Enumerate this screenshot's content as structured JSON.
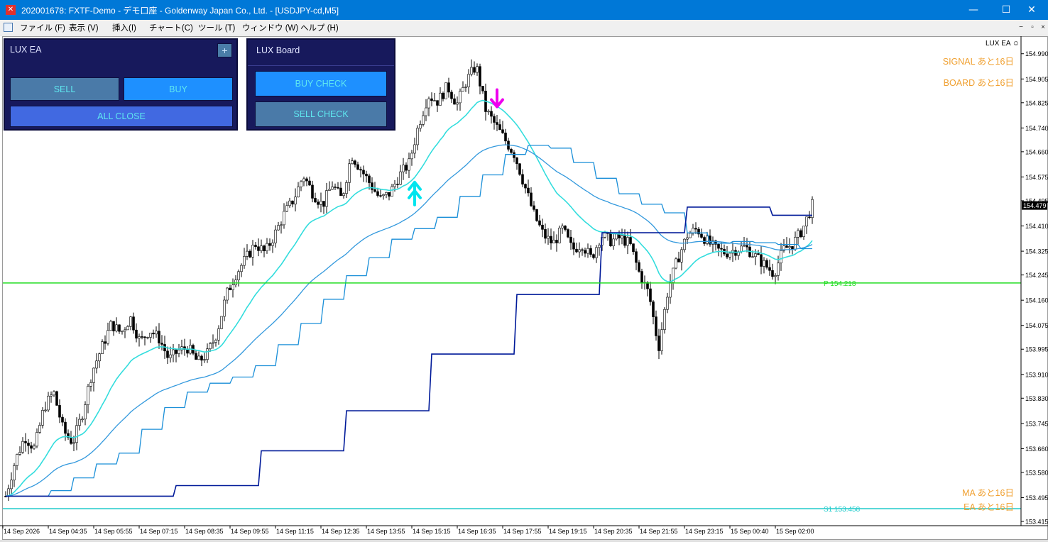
{
  "window": {
    "title": "202001678: FXTF-Demo - デモ口座 - Goldenway Japan Co., Ltd. - [USDJPY-cd,M5]",
    "min_glyph": "—",
    "max_glyph": "☐",
    "close_glyph": "✕",
    "accent_color": "#0078d7"
  },
  "menu": {
    "items": [
      "ファイル (F)",
      "表示 (V)",
      "挿入(I)",
      "チャート(C)",
      "ツール (T)",
      "ウィンドウ (W)",
      "ヘルプ (H)"
    ],
    "mdi_buttons": [
      "−",
      "▫",
      "×"
    ]
  },
  "lux_ea_panel": {
    "title": "LUX EA",
    "plus_label": "+",
    "sell_label": "SELL",
    "buy_label": "BUY",
    "close_all_label": "ALL CLOSE"
  },
  "lux_board_panel": {
    "title": "LUX Board",
    "buy_check_label": "BUY CHECK",
    "sell_check_label": "SELL CHECK"
  },
  "indicator_label": "LUX EA ☺",
  "signals": {
    "signal": "SIGNAL あと16日",
    "board": "BOARD あと16日",
    "ma": "MA あと16日",
    "ea": "EA あと16日"
  },
  "chart_data": {
    "type": "candlestick",
    "symbol": "USDJPY-cd",
    "timeframe": "M5",
    "ylim": [
      153.415,
      155.03
    ],
    "y_ticks": [
      "154.990",
      "154.905",
      "154.825",
      "154.740",
      "154.660",
      "154.575",
      "154.495",
      "154.410",
      "154.325",
      "154.245",
      "154.160",
      "154.075",
      "153.995",
      "153.910",
      "153.830",
      "153.745",
      "153.660",
      "153.580",
      "153.495",
      "153.415"
    ],
    "current_price": "154.479",
    "x_ticks": [
      "14 Sep 2026",
      "14 Sep 04:35",
      "14 Sep 05:55",
      "14 Sep 07:15",
      "14 Sep 08:35",
      "14 Sep 09:55",
      "14 Sep 11:15",
      "14 Sep 12:35",
      "14 Sep 13:55",
      "14 Sep 15:15",
      "14 Sep 16:35",
      "14 Sep 17:55",
      "14 Sep 19:15",
      "14 Sep 20:35",
      "14 Sep 21:55",
      "14 Sep 23:15",
      "15 Sep 00:40",
      "15 Sep 02:00"
    ],
    "closes": [
      153.5,
      153.62,
      153.7,
      153.66,
      153.8,
      153.85,
      153.72,
      153.68,
      153.78,
      153.92,
      154.0,
      154.08,
      154.05,
      154.1,
      154.02,
      154.06,
      154.03,
      153.96,
      153.99,
      154.0,
      153.95,
      153.98,
      154.05,
      154.18,
      154.25,
      154.3,
      154.35,
      154.32,
      154.38,
      154.45,
      154.5,
      154.58,
      154.52,
      154.48,
      154.55,
      154.5,
      154.65,
      154.6,
      154.55,
      154.5,
      154.52,
      154.58,
      154.62,
      154.75,
      154.85,
      154.83,
      154.88,
      154.82,
      154.9,
      154.95,
      154.8,
      154.75,
      154.7,
      154.65,
      154.55,
      154.45,
      154.38,
      154.35,
      154.4,
      154.33,
      154.35,
      154.3,
      154.38,
      154.36,
      154.37,
      154.35,
      154.25,
      154.18,
      154.0,
      154.2,
      154.3,
      154.38,
      154.4,
      154.36,
      154.33,
      154.32,
      154.33,
      154.34,
      154.31,
      154.28,
      154.25,
      154.33,
      154.35,
      154.4,
      154.48
    ],
    "horizontal_lines": [
      {
        "label": "P 154.218",
        "price": 154.218,
        "color": "#22dd22"
      },
      {
        "label": "S1 153.458",
        "price": 153.458,
        "color": "#22cccc"
      }
    ],
    "arrows": [
      {
        "type": "buy",
        "color": "#00e5ee"
      },
      {
        "type": "sell",
        "color": "#ee00ee"
      }
    ],
    "series": [
      {
        "color": "#33dddd"
      },
      {
        "color": "#3399dd"
      },
      {
        "color": "#1a8fd8"
      },
      {
        "color": "#001a99"
      }
    ]
  }
}
